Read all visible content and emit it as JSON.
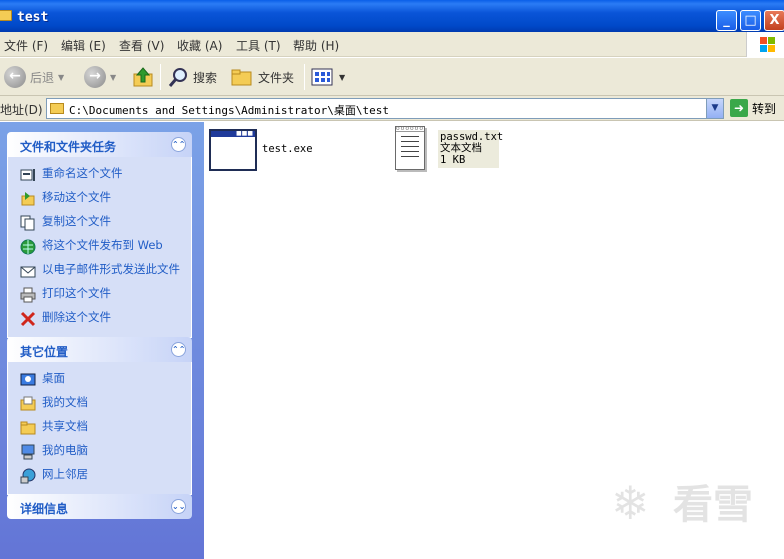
{
  "window": {
    "title": "test",
    "buttons": {
      "minimize": "_",
      "maximize": "□",
      "close": "X"
    }
  },
  "menu": {
    "items": [
      {
        "label": "文件",
        "key": "(F)"
      },
      {
        "label": "编辑",
        "key": "(E)"
      },
      {
        "label": "查看",
        "key": "(V)"
      },
      {
        "label": "收藏",
        "key": "(A)"
      },
      {
        "label": "工具",
        "key": "(T)"
      },
      {
        "label": "帮助",
        "key": "(H)"
      }
    ]
  },
  "toolbar": {
    "back_label": "后退",
    "search_label": "搜索",
    "folders_label": "文件夹",
    "icons": {
      "back": "back-arrow-icon",
      "forward": "forward-arrow-icon",
      "up": "up-folder-icon",
      "search": "search-magnifier-icon",
      "folders": "folders-icon",
      "views": "views-icon"
    }
  },
  "address": {
    "label": "地址(D)",
    "path": "C:\\Documents and Settings\\Administrator\\桌面\\test",
    "go_label": "转到"
  },
  "left_pane": {
    "file_tasks": {
      "title": "文件和文件夹任务",
      "items": [
        {
          "label": "重命名这个文件",
          "icon": "rename-icon"
        },
        {
          "label": "移动这个文件",
          "icon": "move-icon"
        },
        {
          "label": "复制这个文件",
          "icon": "copy-icon"
        },
        {
          "label": "将这个文件发布到 Web",
          "icon": "publish-web-icon"
        },
        {
          "label": "以电子邮件形式发送此文件",
          "icon": "email-icon"
        },
        {
          "label": "打印这个文件",
          "icon": "printer-icon"
        },
        {
          "label": "删除这个文件",
          "icon": "delete-icon"
        }
      ]
    },
    "other_places": {
      "title": "其它位置",
      "items": [
        {
          "label": "桌面",
          "icon": "desktop-icon"
        },
        {
          "label": "我的文档",
          "icon": "my-documents-icon"
        },
        {
          "label": "共享文档",
          "icon": "shared-documents-icon"
        },
        {
          "label": "我的电脑",
          "icon": "my-computer-icon"
        },
        {
          "label": "网上邻居",
          "icon": "network-places-icon"
        }
      ]
    },
    "details": {
      "title": "详细信息"
    }
  },
  "files": [
    {
      "name": "test.exe",
      "icon": "application-exe-icon"
    },
    {
      "name": "passwd.txt",
      "type": "文本文档",
      "size": "1 KB",
      "icon": "text-document-icon",
      "selected": true
    }
  ],
  "watermark": {
    "text": "看雪",
    "icon": "snowflake-icon"
  },
  "colors": {
    "title_bar": "#0a55d8",
    "task_pane": "#6f8ee0",
    "link": "#215dc6",
    "selection": "#ecebdc"
  }
}
